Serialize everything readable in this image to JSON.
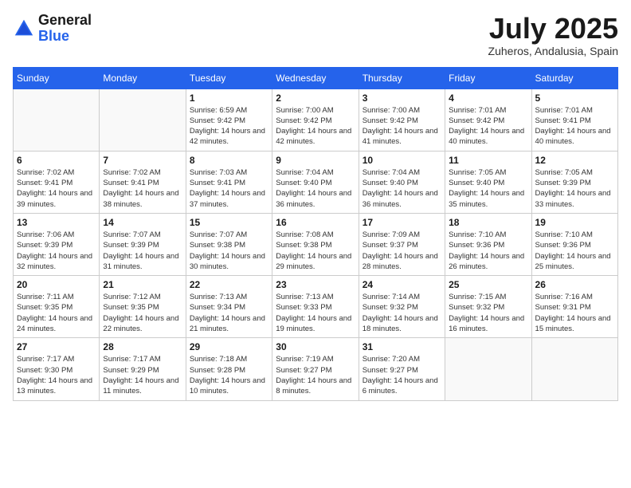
{
  "header": {
    "logo_general": "General",
    "logo_blue": "Blue",
    "month": "July 2025",
    "location": "Zuheros, Andalusia, Spain"
  },
  "days_of_week": [
    "Sunday",
    "Monday",
    "Tuesday",
    "Wednesday",
    "Thursday",
    "Friday",
    "Saturday"
  ],
  "weeks": [
    [
      {
        "day": "",
        "info": ""
      },
      {
        "day": "",
        "info": ""
      },
      {
        "day": "1",
        "info": "Sunrise: 6:59 AM\nSunset: 9:42 PM\nDaylight: 14 hours and 42 minutes."
      },
      {
        "day": "2",
        "info": "Sunrise: 7:00 AM\nSunset: 9:42 PM\nDaylight: 14 hours and 42 minutes."
      },
      {
        "day": "3",
        "info": "Sunrise: 7:00 AM\nSunset: 9:42 PM\nDaylight: 14 hours and 41 minutes."
      },
      {
        "day": "4",
        "info": "Sunrise: 7:01 AM\nSunset: 9:42 PM\nDaylight: 14 hours and 40 minutes."
      },
      {
        "day": "5",
        "info": "Sunrise: 7:01 AM\nSunset: 9:41 PM\nDaylight: 14 hours and 40 minutes."
      }
    ],
    [
      {
        "day": "6",
        "info": "Sunrise: 7:02 AM\nSunset: 9:41 PM\nDaylight: 14 hours and 39 minutes."
      },
      {
        "day": "7",
        "info": "Sunrise: 7:02 AM\nSunset: 9:41 PM\nDaylight: 14 hours and 38 minutes."
      },
      {
        "day": "8",
        "info": "Sunrise: 7:03 AM\nSunset: 9:41 PM\nDaylight: 14 hours and 37 minutes."
      },
      {
        "day": "9",
        "info": "Sunrise: 7:04 AM\nSunset: 9:40 PM\nDaylight: 14 hours and 36 minutes."
      },
      {
        "day": "10",
        "info": "Sunrise: 7:04 AM\nSunset: 9:40 PM\nDaylight: 14 hours and 36 minutes."
      },
      {
        "day": "11",
        "info": "Sunrise: 7:05 AM\nSunset: 9:40 PM\nDaylight: 14 hours and 35 minutes."
      },
      {
        "day": "12",
        "info": "Sunrise: 7:05 AM\nSunset: 9:39 PM\nDaylight: 14 hours and 33 minutes."
      }
    ],
    [
      {
        "day": "13",
        "info": "Sunrise: 7:06 AM\nSunset: 9:39 PM\nDaylight: 14 hours and 32 minutes."
      },
      {
        "day": "14",
        "info": "Sunrise: 7:07 AM\nSunset: 9:39 PM\nDaylight: 14 hours and 31 minutes."
      },
      {
        "day": "15",
        "info": "Sunrise: 7:07 AM\nSunset: 9:38 PM\nDaylight: 14 hours and 30 minutes."
      },
      {
        "day": "16",
        "info": "Sunrise: 7:08 AM\nSunset: 9:38 PM\nDaylight: 14 hours and 29 minutes."
      },
      {
        "day": "17",
        "info": "Sunrise: 7:09 AM\nSunset: 9:37 PM\nDaylight: 14 hours and 28 minutes."
      },
      {
        "day": "18",
        "info": "Sunrise: 7:10 AM\nSunset: 9:36 PM\nDaylight: 14 hours and 26 minutes."
      },
      {
        "day": "19",
        "info": "Sunrise: 7:10 AM\nSunset: 9:36 PM\nDaylight: 14 hours and 25 minutes."
      }
    ],
    [
      {
        "day": "20",
        "info": "Sunrise: 7:11 AM\nSunset: 9:35 PM\nDaylight: 14 hours and 24 minutes."
      },
      {
        "day": "21",
        "info": "Sunrise: 7:12 AM\nSunset: 9:35 PM\nDaylight: 14 hours and 22 minutes."
      },
      {
        "day": "22",
        "info": "Sunrise: 7:13 AM\nSunset: 9:34 PM\nDaylight: 14 hours and 21 minutes."
      },
      {
        "day": "23",
        "info": "Sunrise: 7:13 AM\nSunset: 9:33 PM\nDaylight: 14 hours and 19 minutes."
      },
      {
        "day": "24",
        "info": "Sunrise: 7:14 AM\nSunset: 9:32 PM\nDaylight: 14 hours and 18 minutes."
      },
      {
        "day": "25",
        "info": "Sunrise: 7:15 AM\nSunset: 9:32 PM\nDaylight: 14 hours and 16 minutes."
      },
      {
        "day": "26",
        "info": "Sunrise: 7:16 AM\nSunset: 9:31 PM\nDaylight: 14 hours and 15 minutes."
      }
    ],
    [
      {
        "day": "27",
        "info": "Sunrise: 7:17 AM\nSunset: 9:30 PM\nDaylight: 14 hours and 13 minutes."
      },
      {
        "day": "28",
        "info": "Sunrise: 7:17 AM\nSunset: 9:29 PM\nDaylight: 14 hours and 11 minutes."
      },
      {
        "day": "29",
        "info": "Sunrise: 7:18 AM\nSunset: 9:28 PM\nDaylight: 14 hours and 10 minutes."
      },
      {
        "day": "30",
        "info": "Sunrise: 7:19 AM\nSunset: 9:27 PM\nDaylight: 14 hours and 8 minutes."
      },
      {
        "day": "31",
        "info": "Sunrise: 7:20 AM\nSunset: 9:27 PM\nDaylight: 14 hours and 6 minutes."
      },
      {
        "day": "",
        "info": ""
      },
      {
        "day": "",
        "info": ""
      }
    ]
  ]
}
